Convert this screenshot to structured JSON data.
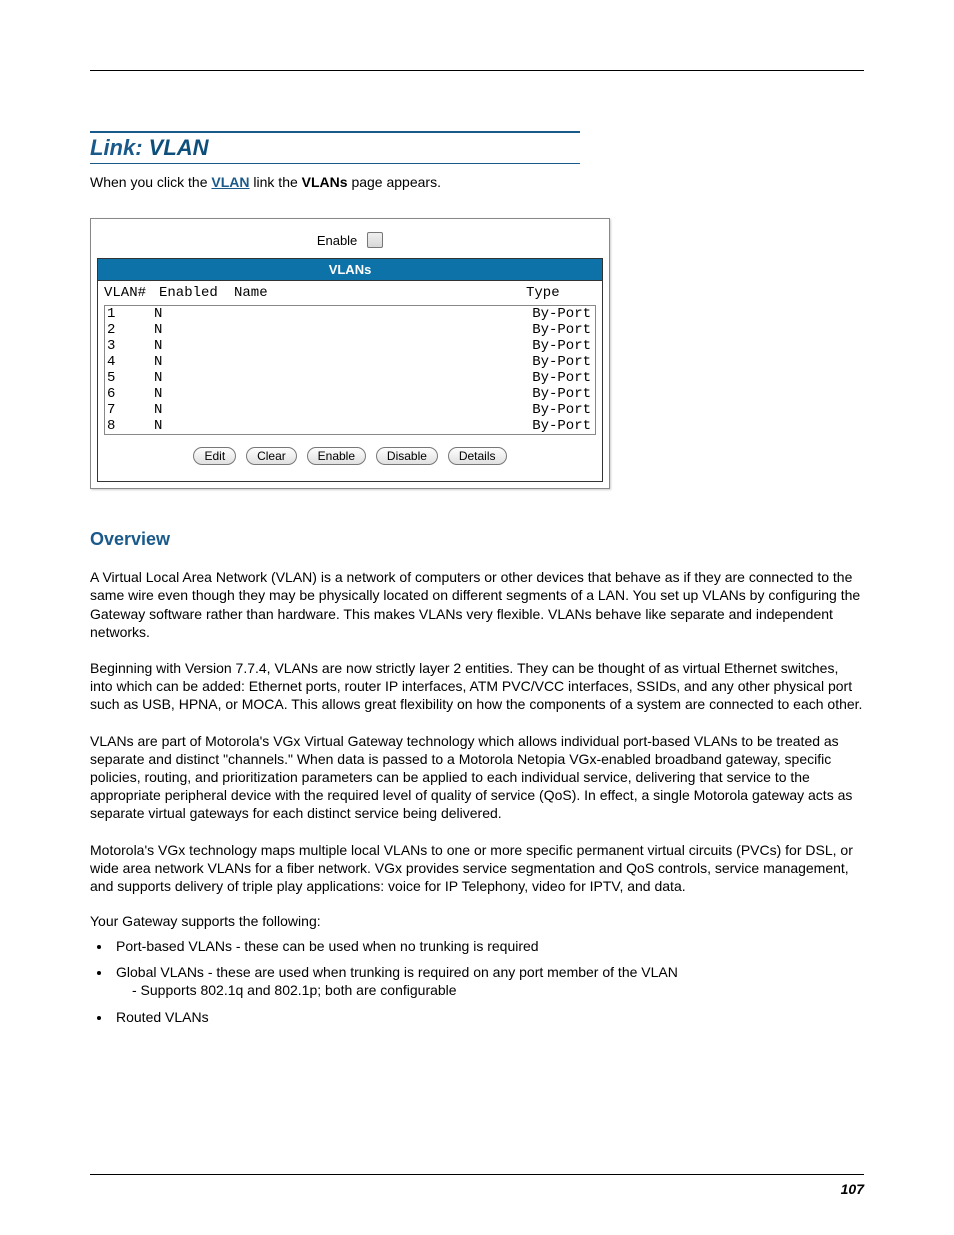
{
  "page_number": "107",
  "section": {
    "title_prefix": "Link: ",
    "title_link": "VLAN"
  },
  "intro": {
    "pre": "When you click the ",
    "link": "VLAN",
    "mid": " link the ",
    "bold": "VLANs",
    "post": " page appears."
  },
  "panel": {
    "enable_label": "Enable",
    "header": "VLANs",
    "columns": {
      "num": "VLAN#",
      "enabled": "Enabled",
      "name": "Name",
      "type": "Type"
    },
    "rows": [
      {
        "num": "1",
        "enabled": "N",
        "name": "",
        "type": "By-Port"
      },
      {
        "num": "2",
        "enabled": "N",
        "name": "",
        "type": "By-Port"
      },
      {
        "num": "3",
        "enabled": "N",
        "name": "",
        "type": "By-Port"
      },
      {
        "num": "4",
        "enabled": "N",
        "name": "",
        "type": "By-Port"
      },
      {
        "num": "5",
        "enabled": "N",
        "name": "",
        "type": "By-Port"
      },
      {
        "num": "6",
        "enabled": "N",
        "name": "",
        "type": "By-Port"
      },
      {
        "num": "7",
        "enabled": "N",
        "name": "",
        "type": "By-Port"
      },
      {
        "num": "8",
        "enabled": "N",
        "name": "",
        "type": "By-Port"
      }
    ],
    "buttons": {
      "edit": "Edit",
      "clear": "Clear",
      "enable": "Enable",
      "disable": "Disable",
      "details": "Details"
    }
  },
  "overview": {
    "title": "Overview",
    "p1": "A Virtual Local Area Network (VLAN) is a network of computers or other devices that behave as if they are connected to the same wire even though they may be physically located on different segments of a LAN. You set up VLANs by configuring the Gateway software rather than hardware. This makes VLANs very flexible. VLANs behave like separate and independent networks.",
    "p2": "Beginning with Version 7.7.4, VLANs are now strictly layer 2 entities. They can be thought of as virtual Ethernet switches, into which can be added: Ethernet ports, router IP interfaces, ATM PVC/VCC interfaces, SSIDs, and any other physical port such as USB, HPNA, or MOCA. This allows great flexibility on how the components of a system are connected to each other.",
    "p3": "VLANs are part of Motorola's VGx Virtual Gateway technology which allows individual port-based VLANs to be treated as separate and distinct \"channels.\" When data is passed to a Motorola Netopia VGx-enabled broadband gateway, specific policies, routing, and prioritization parameters can be applied to each individual service, delivering that service to the appropriate peripheral device with the required level of quality of service (QoS). In effect, a single Motorola gateway acts as separate virtual gateways for each distinct service being delivered.",
    "p4": "Motorola's VGx technology maps multiple local VLANs to one or more specific permanent virtual circuits (PVCs) for DSL, or wide area network VLANs for a fiber network. VGx provides service segmentation and QoS controls, service management, and supports delivery of triple play applications: voice for IP Telephony, video for IPTV, and data.",
    "supports": "Your Gateway supports the following:",
    "bullets": {
      "b1": "Port-based VLANs - these can be used when no trunking is required",
      "b2": "Global VLANs - these are used when trunking is required on any port member of the VLAN",
      "b2sub": "- Supports 802.1q and 802.1p; both are configurable",
      "b3": "Routed VLANs"
    }
  }
}
